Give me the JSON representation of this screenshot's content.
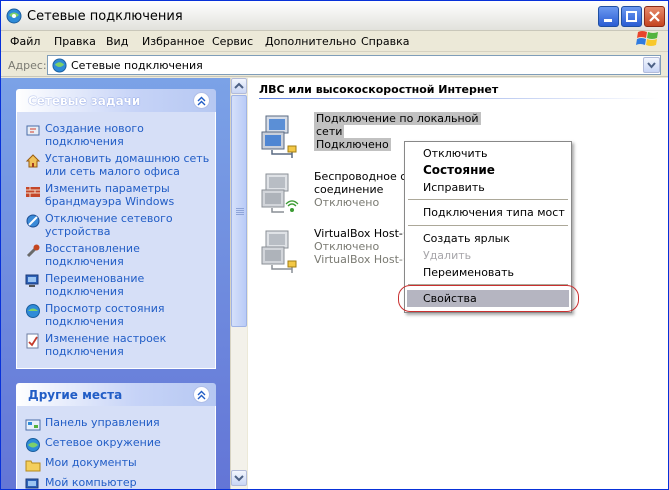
{
  "window": {
    "title": "Сетевые подключения"
  },
  "menu": [
    "Файл",
    "Правка",
    "Вид",
    "Избранное",
    "Сервис",
    "Дополнительно",
    "Справка"
  ],
  "address": {
    "label": "Адрес:",
    "value": "Сетевые подключения"
  },
  "tasks_panel": {
    "title": "Сетевые задачи",
    "items": [
      {
        "label": "Создание нового подключения",
        "icon": "new-connection-icon"
      },
      {
        "label": "Установить домашнюю сеть или сеть малого офиса",
        "icon": "home-network-icon"
      },
      {
        "label": "Изменить параметры брандмауэра Windows",
        "icon": "firewall-icon"
      },
      {
        "label": "Отключение сетевого устройства",
        "icon": "disable-device-icon"
      },
      {
        "label": "Восстановление подключения",
        "icon": "repair-icon"
      },
      {
        "label": "Переименование подключения",
        "icon": "rename-icon"
      },
      {
        "label": "Просмотр состояния подключения",
        "icon": "status-icon"
      },
      {
        "label": "Изменение настроек подключения",
        "icon": "settings-icon"
      }
    ]
  },
  "places_panel": {
    "title": "Другие места",
    "items": [
      {
        "label": "Панель управления",
        "icon": "control-panel-icon"
      },
      {
        "label": "Сетевое окружение",
        "icon": "network-places-icon"
      },
      {
        "label": "Мои документы",
        "icon": "my-documents-icon"
      },
      {
        "label": "Мой компьютер",
        "icon": "my-computer-icon"
      }
    ]
  },
  "group": {
    "title": "ЛВС или высокоскоростной Интернет"
  },
  "connections": [
    {
      "name_line1": "Подключение по локальной",
      "name_line2": "сети",
      "status": "Подключено",
      "device": ""
    },
    {
      "name_line1": "Беспроводное сет",
      "name_line2": "соединение",
      "status": "Отключено",
      "device": ""
    },
    {
      "name_line1": "VirtualBox Host-On",
      "name_line2": "",
      "status": "Отключено",
      "device": "VirtualBox Host-On"
    }
  ],
  "context_menu": {
    "items": [
      {
        "label": "Отключить",
        "style": "normal"
      },
      {
        "label": "Состояние",
        "style": "bold"
      },
      {
        "label": "Исправить",
        "style": "normal"
      },
      {
        "label": "Подключения типа мост",
        "style": "normal"
      },
      {
        "label": "Создать ярлык",
        "style": "normal"
      },
      {
        "label": "Удалить",
        "style": "disabled"
      },
      {
        "label": "Переименовать",
        "style": "normal"
      },
      {
        "label": "Свойства",
        "style": "highlighted"
      }
    ]
  },
  "colors": {
    "title_bar": "#f3f3f1",
    "task_pane": "#7ba2e7",
    "link": "#215dc6",
    "selection": "#b5b5c1",
    "annotation": "#c93030"
  }
}
